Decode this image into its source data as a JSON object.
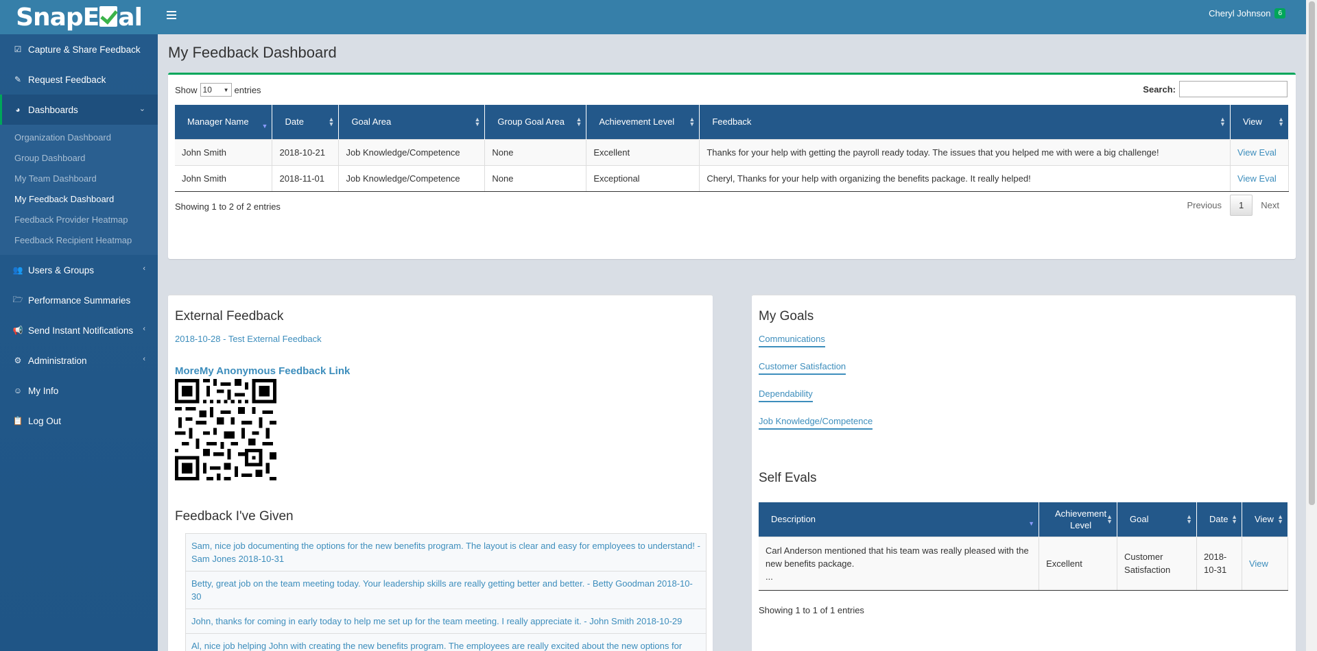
{
  "header": {
    "logo": {
      "pre": "SnapE",
      "post": "al"
    },
    "user_name": "Cheryl Johnson",
    "badge_count": "6"
  },
  "sidebar": {
    "items": [
      {
        "label": "Capture & Share Feedback",
        "icon": "check-square-icon"
      },
      {
        "label": "Request Feedback",
        "icon": "edit-icon"
      },
      {
        "label": "Dashboards",
        "icon": "pie-chart-icon"
      },
      {
        "label": "Users & Groups",
        "icon": "users-icon"
      },
      {
        "label": "Performance Summaries",
        "icon": "folder-open-icon"
      },
      {
        "label": "Send Instant Notifications",
        "icon": "bullhorn-icon"
      },
      {
        "label": "Administration",
        "icon": "gear-icon"
      },
      {
        "label": "My Info",
        "icon": "smile-icon"
      },
      {
        "label": "Log Out",
        "icon": "clipboard-icon"
      }
    ],
    "dashboards_sub": [
      "Organization Dashboard",
      "Group Dashboard",
      "My Team Dashboard",
      "My Feedback Dashboard",
      "Feedback Provider Heatmap",
      "Feedback Recipient Heatmap"
    ]
  },
  "page": {
    "title": "My Feedback Dashboard"
  },
  "feedback_table": {
    "show_label": "Show",
    "entries_value": "10",
    "entries_label": "entries",
    "search_label": "Search:",
    "columns": [
      "Manager Name",
      "Date",
      "Goal Area",
      "Group Goal Area",
      "Achievement Level",
      "Feedback",
      "View"
    ],
    "rows": [
      {
        "manager": "John Smith",
        "date": "2018-10-21",
        "goal": "Job Knowledge/Competence",
        "group_goal": "None",
        "level": "Excellent",
        "feedback": "Thanks for your help with getting the payroll ready today. The issues that you helped me with were a big challenge!",
        "view": "View Eval"
      },
      {
        "manager": "John Smith",
        "date": "2018-11-01",
        "goal": "Job Knowledge/Competence",
        "group_goal": "None",
        "level": "Exceptional",
        "feedback": "Cheryl, Thanks for your help with organizing the benefits package. It really helped!",
        "view": "View Eval"
      }
    ],
    "info": "Showing 1 to 2 of 2 entries",
    "pager": {
      "previous": "Previous",
      "current": "1",
      "next": "Next"
    }
  },
  "external": {
    "title": "External Feedback",
    "link": "2018-10-28 - Test External Feedback",
    "anon_link": "MoreMy Anonymous Feedback Link"
  },
  "given": {
    "title": "Feedback I've Given",
    "items": [
      "Sam, nice job documenting the options for the new benefits program. The layout is clear and easy for employees to understand! - Sam Jones 2018-10-31",
      "Betty, great job on the team meeting today. Your leadership skills are really getting better and better. - Betty Goodman 2018-10-30",
      "John, thanks for coming in early today to help me set up for the team meeting. I really appreciate it. - John Smith 2018-10-29",
      "Al, nice job helping John with creating the new benefits program. The employees are really excited about the new options for"
    ]
  },
  "goals": {
    "title": "My Goals",
    "items": [
      "Communications",
      "Customer Satisfaction",
      "Dependability",
      "Job Knowledge/Competence"
    ]
  },
  "self_evals": {
    "title": "Self Evals",
    "columns": [
      "Description",
      "Achievement Level",
      "Goal",
      "Date",
      "View"
    ],
    "rows": [
      {
        "description": "Carl Anderson mentioned that his team was really pleased with the new benefits package.",
        "more": "...",
        "level": "Excellent",
        "goal": "Customer Satisfaction",
        "date": "2018-10-31",
        "view": "View"
      }
    ],
    "info": "Showing 1 to 1 of 1 entries"
  },
  "colors": {
    "header": "#367fa9",
    "sidebar": "#23588a",
    "accent": "#00a65a",
    "link": "#3c8dbc"
  }
}
